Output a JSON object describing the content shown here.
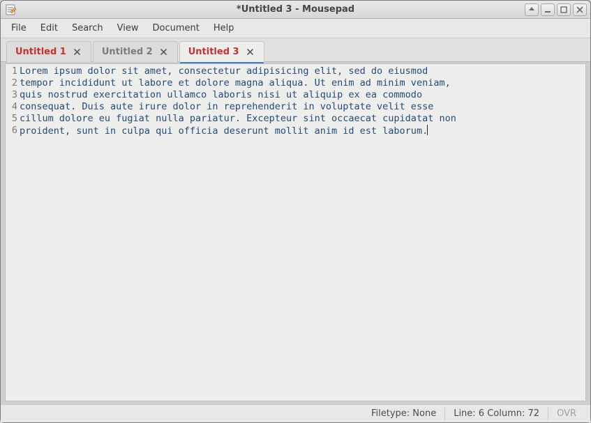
{
  "window": {
    "title": "*Untitled 3 - Mousepad",
    "app_icon_name": "text-editor-icon"
  },
  "menubar": {
    "items": [
      "File",
      "Edit",
      "Search",
      "View",
      "Document",
      "Help"
    ]
  },
  "tabs": [
    {
      "label": "Untitled 1",
      "modified": true,
      "active": false
    },
    {
      "label": "Untitled 2",
      "modified": false,
      "active": false
    },
    {
      "label": "Untitled 3",
      "modified": true,
      "active": true
    }
  ],
  "editor": {
    "lines": [
      "Lorem ipsum dolor sit amet, consectetur adipisicing elit, sed do eiusmod",
      "tempor incididunt ut labore et dolore magna aliqua. Ut enim ad minim veniam,",
      "quis nostrud exercitation ullamco laboris nisi ut aliquip ex ea commodo",
      "consequat. Duis aute irure dolor in reprehenderit in voluptate velit esse",
      "cillum dolore eu fugiat nulla pariatur. Excepteur sint occaecat cupidatat non",
      "proident, sunt in culpa qui officia deserunt mollit anim id est laborum."
    ],
    "cursor_line_index": 5
  },
  "statusbar": {
    "filetype_label": "Filetype: None",
    "position_label": "Line: 6 Column: 72",
    "overwrite_mode": "OVR"
  }
}
